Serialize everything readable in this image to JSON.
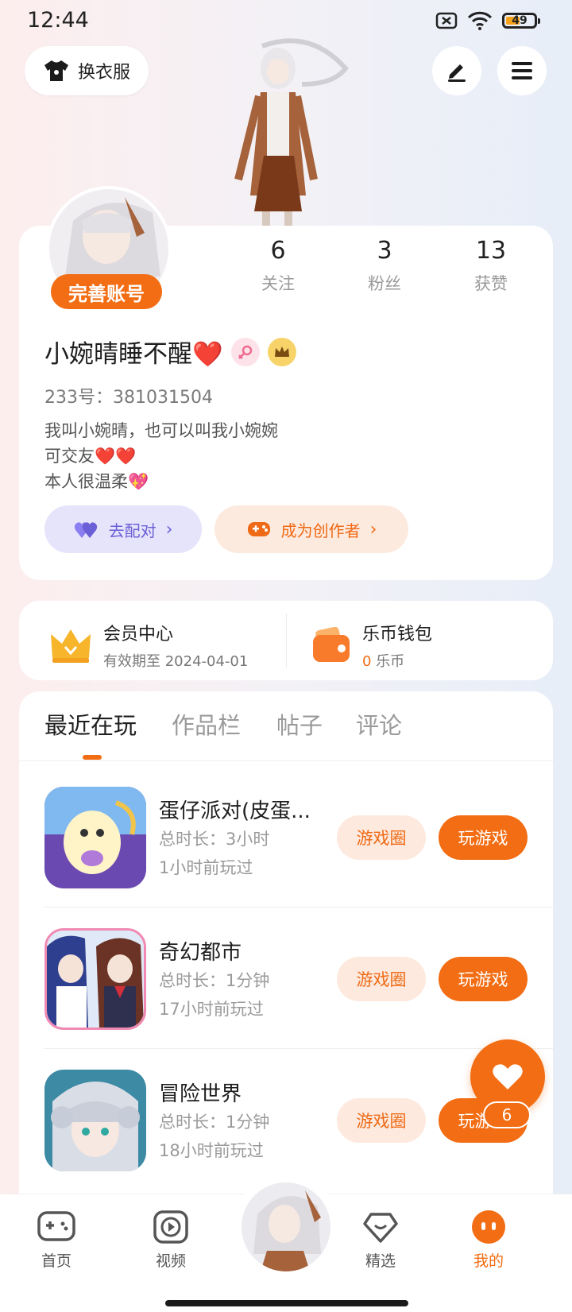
{
  "status_bar": {
    "time": "12:44",
    "battery": "49"
  },
  "header": {
    "outfit_label": "换衣服"
  },
  "profile": {
    "complete_badge": "完善账号",
    "stats": [
      {
        "value": "6",
        "label": "关注"
      },
      {
        "value": "3",
        "label": "粉丝"
      },
      {
        "value": "13",
        "label": "获赞"
      }
    ],
    "username": "小婉晴睡不醒❤️",
    "uid": "233号：381031504",
    "bio": [
      "我叫小婉晴，也可以叫我小婉婉",
      "可交友❤️❤️",
      "本人很温柔💖"
    ],
    "match_label": "去配对",
    "creator_label": "成为创作者"
  },
  "member": {
    "title": "会员中心",
    "expiry": "有效期至 2024-04-01",
    "wallet_title": "乐币钱包",
    "wallet_amount": "0",
    "wallet_unit": "乐币"
  },
  "tabs": [
    {
      "label": "最近在玩",
      "active": true
    },
    {
      "label": "作品栏",
      "active": false
    },
    {
      "label": "帖子",
      "active": false
    },
    {
      "label": "评论",
      "active": false
    }
  ],
  "games": [
    {
      "title": "蛋仔派对(皮蛋...",
      "duration": "总时长：3小时",
      "last_played": "1小时前玩过",
      "circle_label": "游戏圈",
      "play_label": "玩游戏"
    },
    {
      "title": "奇幻都市",
      "duration": "总时长：1分钟",
      "last_played": "17小时前玩过",
      "circle_label": "游戏圈",
      "play_label": "玩游戏"
    },
    {
      "title": "冒险世界",
      "duration": "总时长：1分钟",
      "last_played": "18小时前玩过",
      "circle_label": "游戏圈",
      "play_label": "玩游戏"
    }
  ],
  "fab": {
    "count": "6"
  },
  "nav": [
    {
      "label": "首页",
      "icon": "gamepad-icon"
    },
    {
      "label": "视频",
      "icon": "play-icon"
    },
    {
      "label": "",
      "icon": "character-avatar"
    },
    {
      "label": "精选",
      "icon": "heart-diamond-icon"
    },
    {
      "label": "我的",
      "icon": "face-icon",
      "active": true
    }
  ],
  "colors": {
    "accent": "#f26d13",
    "match": "#6a5fd6"
  }
}
